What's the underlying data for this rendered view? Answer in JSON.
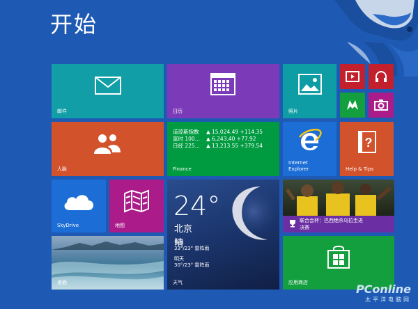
{
  "header": {
    "title": "开始"
  },
  "tiles": {
    "mail": {
      "label": "邮件",
      "color": "#119EA6"
    },
    "calendar": {
      "label": "日历",
      "color": "#7B3BB9"
    },
    "photos": {
      "label": "照片",
      "color": "#0E9DA5"
    },
    "people": {
      "label": "人脉",
      "color": "#D2522C"
    },
    "finance": {
      "label": "Finance",
      "color": "#009B41",
      "rows": [
        {
          "name": "道琼斯指数",
          "arrow": "▲",
          "value": "15,024.49 +114.35"
        },
        {
          "name": "富时 100...",
          "arrow": "▲",
          "value": "6,243.40 +77.92"
        },
        {
          "name": "日经 225...",
          "arrow": "▲",
          "value": "13,213.55 +379.54"
        }
      ]
    },
    "ie": {
      "label_line1": "Internet",
      "label_line2": "Explorer",
      "color": "#1C6DD6"
    },
    "help": {
      "label": "Help & Tips",
      "color": "#D2522C"
    },
    "small_video": {
      "color": "#C1202C",
      "icon": "video-icon"
    },
    "small_music": {
      "color": "#C1202C",
      "icon": "headphones-icon"
    },
    "small_games": {
      "color": "#149F3F",
      "icon": "xbox-controller-icon"
    },
    "small_camera": {
      "color": "#AC1B8A",
      "icon": "camera-icon"
    },
    "skydrive": {
      "label": "SkyDrive",
      "color": "#1C6DD6"
    },
    "maps": {
      "label": "地图",
      "color": "#AC1B8A"
    },
    "weather": {
      "temp": "24°",
      "city": "北京",
      "desc": "晴",
      "today_label": "今日",
      "today_forecast": "33°/23° 雷阵雨",
      "tomorrow_label": "明天",
      "tomorrow_forecast": "30°/23° 雷阵雨",
      "label": "天气",
      "color": "#1C3770"
    },
    "sports": {
      "headline_line1": "联合会杯：巴西绝杀乌拉圭进",
      "headline_line2": "决赛",
      "color": "#6B2FA3"
    },
    "desktop": {
      "label": "桌面"
    },
    "store": {
      "label": "应用商店",
      "color": "#149F3F"
    }
  },
  "watermark": {
    "logo": "PConline",
    "sub": "太平洋电脑网"
  }
}
